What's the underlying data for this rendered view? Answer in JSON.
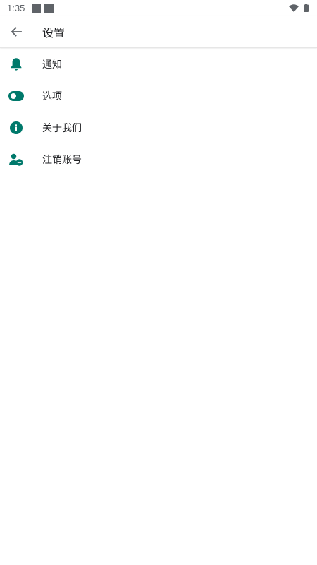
{
  "status_bar": {
    "time": "1:35"
  },
  "app_bar": {
    "title": "设置"
  },
  "settings": {
    "items": [
      {
        "label": "通知",
        "icon": "bell-icon"
      },
      {
        "label": "选项",
        "icon": "toggle-icon"
      },
      {
        "label": "关于我们",
        "icon": "info-icon"
      },
      {
        "label": "注销账号",
        "icon": "person-remove-icon"
      }
    ]
  },
  "colors": {
    "accent": "#00796B",
    "text": "#202124",
    "status_icons": "#5f6368"
  }
}
